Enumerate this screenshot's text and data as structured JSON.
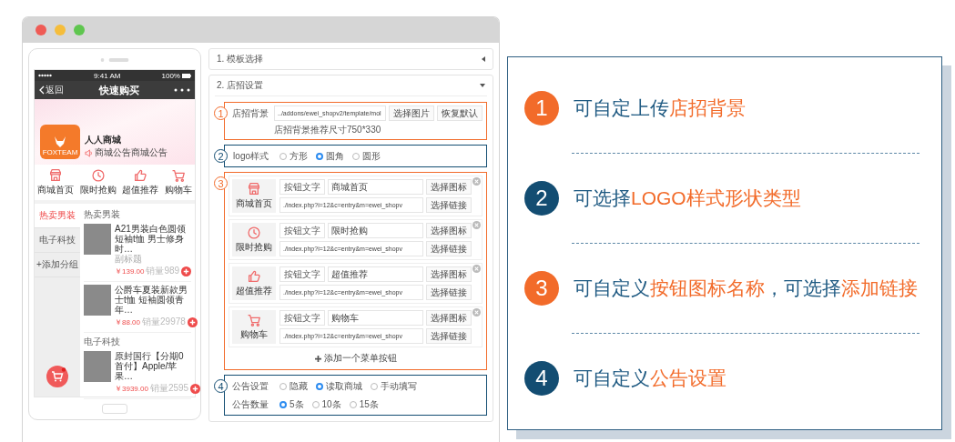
{
  "browser": {
    "window_controls": [
      {
        "color": "#ef5b55"
      },
      {
        "color": "#f5bd3b"
      },
      {
        "color": "#5fc64f"
      }
    ]
  },
  "phone": {
    "status_bar": {
      "time": "9:41 AM",
      "battery": "100%"
    },
    "nav_bar": {
      "back": "返回",
      "title": "快速购买"
    },
    "shop": {
      "logo_text": "FOXTEAM",
      "name": "人人商城",
      "notice": "商城公告商城公告"
    },
    "shortcuts": [
      {
        "label": "商城首页"
      },
      {
        "label": "限时抢购"
      },
      {
        "label": "超值推荐"
      },
      {
        "label": "购物车"
      }
    ],
    "categories": [
      {
        "label": "热卖男装",
        "selected": true
      },
      {
        "label": "电子科技",
        "selected": false
      },
      {
        "label": "+添加分组",
        "selected": false
      }
    ],
    "sections": [
      {
        "title": "热卖男装",
        "products": [
          {
            "title": "A21男装白色圆领短袖t恤 男士修身时…",
            "subtitle": "副标题",
            "price": "￥139.00",
            "sales": "销量989"
          },
          {
            "title": "公爵车夏装新款男士t恤 短袖圆领青年…",
            "price": "￥88.00",
            "sales": "销量29978"
          }
        ]
      },
      {
        "title": "电子科技",
        "products": [
          {
            "title": "原封国行【分期0首付】Apple/苹果…",
            "price": "￥3939.00",
            "sales": "销量2595"
          }
        ]
      }
    ]
  },
  "settings": {
    "panels": [
      {
        "title": "1. 模板选择",
        "expanded": false
      },
      {
        "title": "2. 店招设置",
        "expanded": true,
        "groups": [
          {
            "kind": "background",
            "marker": "1",
            "color": "#f26b2a",
            "label": "店招背景",
            "path": "../addons/ewei_shopv2/template/mol",
            "buttons": [
              "选择图片",
              "恢复默认"
            ],
            "hint": "店招背景推荐尺寸750*330"
          },
          {
            "kind": "radios",
            "marker": "2",
            "color": "#134d72",
            "rows": [
              {
                "label": "logo样式",
                "options": [
                  {
                    "label": "方形",
                    "selected": false
                  },
                  {
                    "label": "圆角",
                    "selected": true
                  },
                  {
                    "label": "圆形",
                    "selected": false
                  }
                ]
              }
            ]
          },
          {
            "kind": "menu",
            "marker": "3",
            "color": "#f26b2a",
            "add_button": "添加一个菜单按钮",
            "items": [
              {
                "label": "商城首页",
                "text_label": "按钮文字",
                "text_value": "商城首页",
                "icon_button": "选择图标",
                "link": "./index.php?i=12&c=entry&m=ewei_shopv",
                "link_button": "选择链接"
              },
              {
                "label": "限时抢购",
                "text_label": "按钮文字",
                "text_value": "限时抢购",
                "icon_button": "选择图标",
                "link": "./index.php?i=12&c=entry&m=ewei_shopv",
                "link_button": "选择链接"
              },
              {
                "label": "超值推荐",
                "text_label": "按钮文字",
                "text_value": "超值推荐",
                "icon_button": "选择图标",
                "link": "./index.php?i=12&c=entry&m=ewei_shopv",
                "link_button": "选择链接"
              },
              {
                "label": "购物车",
                "text_label": "按钮文字",
                "text_value": "购物车",
                "icon_button": "选择图标",
                "link": "./index.php?i=12&c=entry&m=ewei_shopv",
                "link_button": "选择链接"
              }
            ]
          },
          {
            "kind": "radios",
            "marker": "4",
            "color": "#134d72",
            "rows": [
              {
                "label": "公告设置",
                "options": [
                  {
                    "label": "隐藏",
                    "selected": false
                  },
                  {
                    "label": "读取商城",
                    "selected": true
                  },
                  {
                    "label": "手动填写",
                    "selected": false
                  }
                ]
              },
              {
                "label": "公告数量",
                "options": [
                  {
                    "label": "5条",
                    "selected": true
                  },
                  {
                    "label": "10条",
                    "selected": false
                  },
                  {
                    "label": "15条",
                    "selected": false
                  }
                ]
              }
            ]
          }
        ]
      }
    ]
  },
  "features": [
    {
      "number": "1",
      "color": "#f26b2a",
      "segments": [
        {
          "text": "可自定上传",
          "highlight": false
        },
        {
          "text": "店招背景",
          "highlight": true
        }
      ]
    },
    {
      "number": "2",
      "color": "#134d72",
      "segments": [
        {
          "text": "可选择",
          "highlight": false
        },
        {
          "text": "LOGO样式形状类型",
          "highlight": true
        }
      ]
    },
    {
      "number": "3",
      "color": "#f26b2a",
      "segments": [
        {
          "text": "可自定义",
          "highlight": false
        },
        {
          "text": "按钮图标名称",
          "highlight": true
        },
        {
          "text": "，可选择",
          "highlight": false
        },
        {
          "text": "添加链接",
          "highlight": true
        }
      ]
    },
    {
      "number": "4",
      "color": "#134d72",
      "segments": [
        {
          "text": "可自定义",
          "highlight": false
        },
        {
          "text": "公告设置",
          "highlight": true
        }
      ]
    }
  ]
}
